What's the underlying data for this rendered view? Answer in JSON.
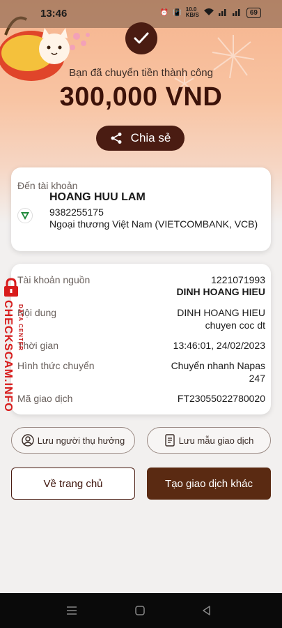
{
  "status_bar": {
    "time": "13:46",
    "network_speed": "10.0\nKB/S",
    "battery": "69"
  },
  "hero": {
    "success_text": "Bạn đã chuyển tiền thành công",
    "amount": "300,000 VND",
    "share_label": "Chia sẻ"
  },
  "destination": {
    "label": "Đến tài khoản",
    "name": "HOANG HUU LAM",
    "account_number": "9382255175",
    "bank": "Ngoại thương Việt Nam (VIETCOMBANK, VCB)"
  },
  "details": {
    "source_label": "Tài khoản nguồn",
    "source_number": "1221071993",
    "source_name": "DINH HOANG HIEU",
    "content_label": "Nội dung",
    "content_line1": "DINH HOANG HIEU",
    "content_line2": "chuyen coc dt",
    "time_label": "Thời gian",
    "time_value": "13:46:01, 24/02/2023",
    "method_label": "Hình thức chuyển",
    "method_line1": "Chuyển nhanh Napas",
    "method_line2": "247",
    "code_label": "Mã giao dịch",
    "code_value": "FT23055022780020"
  },
  "actions": {
    "save_recipient": "Lưu người thụ hưởng",
    "save_template": "Lưu mẫu giao dịch",
    "home": "Về trang chủ",
    "new_transaction": "Tạo giao dịch khác"
  },
  "watermark": {
    "main": "CHECKSCAM.INFO",
    "sub": "DATA CENTER"
  },
  "colors": {
    "primary": "#4a1c12",
    "hero_top": "#f6b48e",
    "watermark": "#d81b1b"
  }
}
